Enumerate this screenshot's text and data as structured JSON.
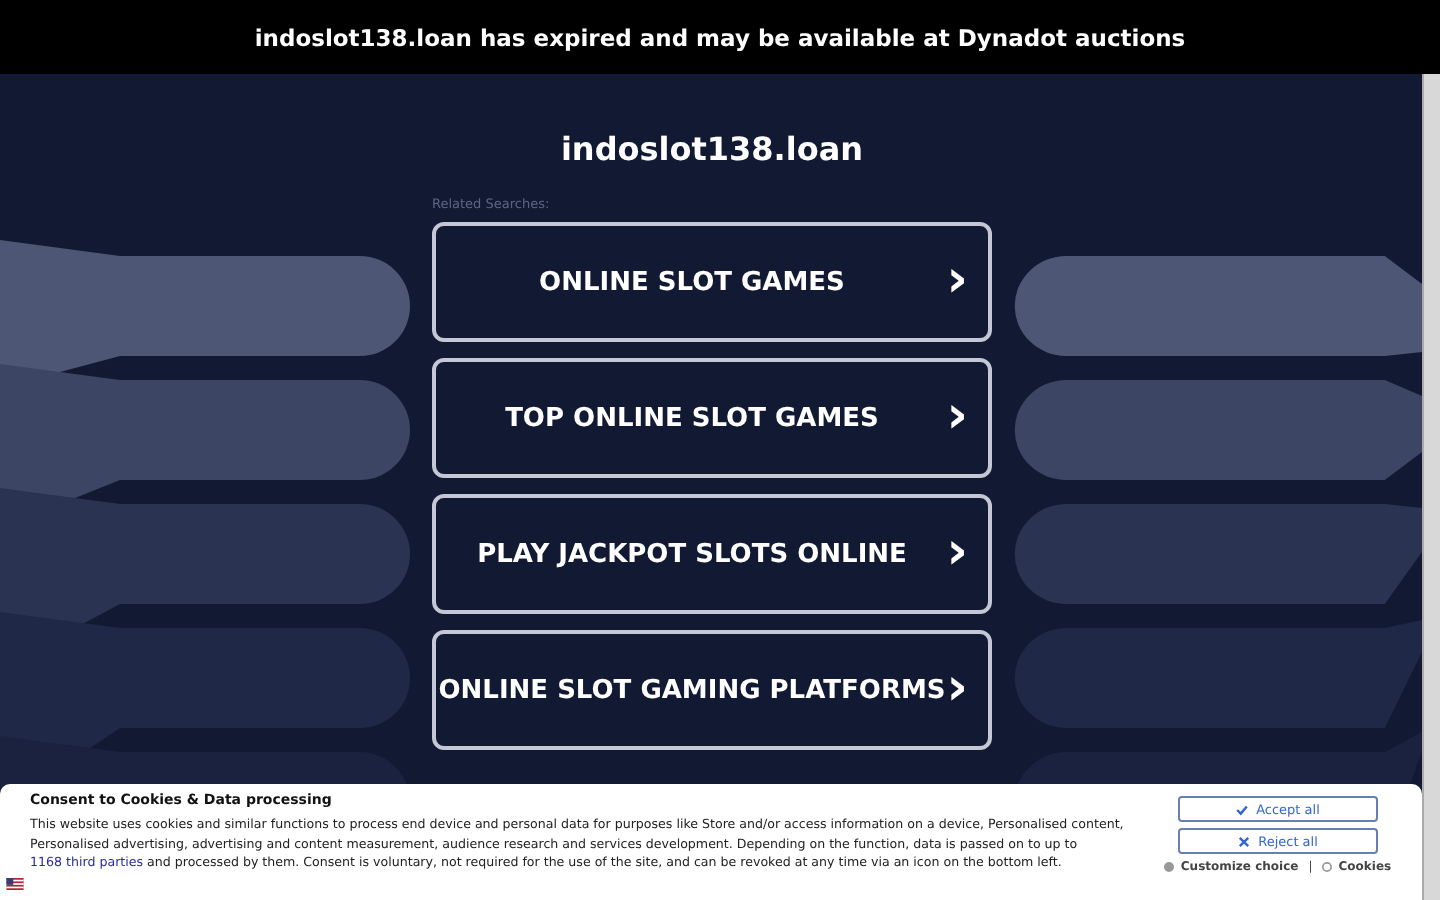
{
  "top_banner": {
    "text": "indoslot138.loan has expired and may be available at Dynadot auctions"
  },
  "domain_title": "indoslot138.loan",
  "related_label": "Related Searches:",
  "searches": [
    {
      "label": "ONLINE SLOT GAMES",
      "arrow": "›"
    },
    {
      "label": "TOP ONLINE SLOT GAMES",
      "arrow": "›"
    },
    {
      "label": "PLAY JACKPOT SLOTS ONLINE",
      "arrow": "›"
    },
    {
      "label": "ONLINE SLOT GAMING PLATFORMS",
      "arrow": "›"
    }
  ],
  "consent": {
    "title": "Consent to Cookies & Data processing",
    "text_before": "This website uses cookies and similar functions to process end device and personal data for purposes like Store and/or access information on a device, Personalised content, Personalised advertising, advertising and content measurement, audience research and services development. Depending on the function, data is passed on to up to ",
    "link": "1168 third parties",
    "text_after": " and processed by them. Consent is voluntary, not required for the use of the site, and can be revoked at any time via an icon on the bottom left.",
    "buttons": [
      {
        "kind": "accept",
        "label": "Accept all"
      },
      {
        "kind": "reject",
        "label": "Reject all"
      }
    ],
    "customize": "Customize choice",
    "separator": "|",
    "cookies": "Cookies"
  }
}
